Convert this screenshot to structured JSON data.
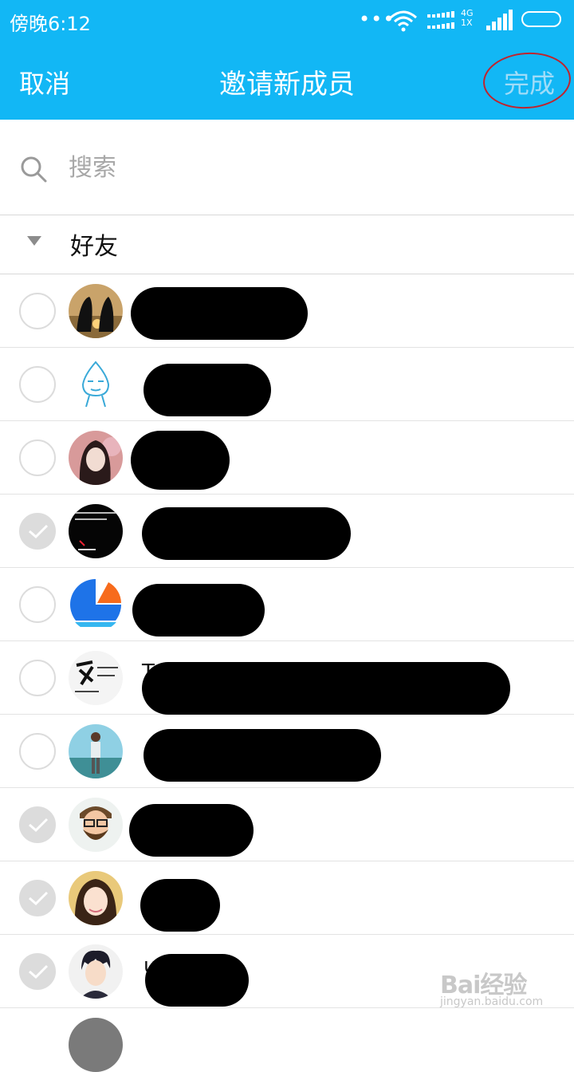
{
  "status_bar": {
    "time": "傍晚6:12",
    "dots": "•••",
    "network_label": "4G\n1X"
  },
  "nav": {
    "cancel_label": "取消",
    "title": "邀请新成员",
    "done_label": "完成"
  },
  "search": {
    "placeholder": "搜索",
    "value": ""
  },
  "group": {
    "label": "好友",
    "expanded": true
  },
  "friends": [
    {
      "checked": false,
      "avatar": "penguins-sunset",
      "name_visible": ""
    },
    {
      "checked": false,
      "avatar": "cartoon-water-drop",
      "name_visible": ""
    },
    {
      "checked": false,
      "avatar": "doll-girl",
      "name_visible": ""
    },
    {
      "checked": true,
      "avatar": "black-text-love",
      "name_visible": ""
    },
    {
      "checked": false,
      "avatar": "blue-orange-logo",
      "name_visible": ""
    },
    {
      "checked": false,
      "avatar": "calligraphy-text",
      "name_visible": "T"
    },
    {
      "checked": false,
      "avatar": "man-by-lake",
      "name_visible": ""
    },
    {
      "checked": true,
      "avatar": "bearded-man-cartoon",
      "name_visible": ""
    },
    {
      "checked": true,
      "avatar": "girl-selfie",
      "name_visible": ""
    },
    {
      "checked": true,
      "avatar": "anime-boy",
      "name_visible": "u"
    }
  ],
  "watermark": {
    "main": "Bai经验",
    "sub": "jingyan.baidu.com"
  },
  "colors": {
    "accent": "#12b7f5",
    "done_disabled": "#9fdcf8",
    "annotation": "#c0242e",
    "check_off_border": "#dcdcdc",
    "check_on": "#dcdcdc"
  }
}
